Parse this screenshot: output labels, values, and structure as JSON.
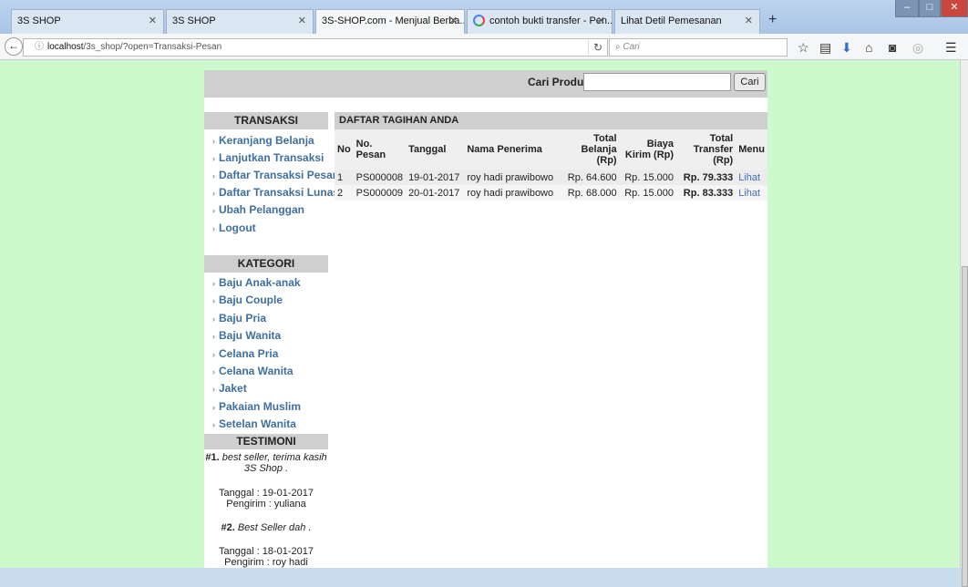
{
  "browser": {
    "tabs": [
      {
        "label": "3S SHOP"
      },
      {
        "label": "3S SHOP"
      },
      {
        "label": "3S-SHOP.com - Menjual Berba..."
      },
      {
        "label": "contoh bukti transfer - Pen..."
      },
      {
        "label": "Lihat Detil Pemesanan"
      }
    ],
    "url_host": "localhost",
    "url_path": "/3s_shop/?open=Transaksi-Pesan",
    "search_placeholder": "Cari"
  },
  "header": {
    "search_label": "Cari Produk",
    "search_value": "",
    "search_button": "Cari"
  },
  "sidebar": {
    "transaksi_title": "TRANSAKSI",
    "transaksi_items": [
      {
        "label": "Keranjang Belanja"
      },
      {
        "label": "Lanjutkan Transaksi"
      },
      {
        "label": "Daftar Transaksi Pesan"
      },
      {
        "label": "Daftar Transaksi Lunas"
      },
      {
        "label": "Ubah Pelanggan"
      },
      {
        "label": "Logout"
      }
    ],
    "kategori_title": "KATEGORI",
    "kategori_items": [
      {
        "label": "Baju Anak-anak"
      },
      {
        "label": "Baju Couple"
      },
      {
        "label": "Baju Pria"
      },
      {
        "label": "Baju Wanita"
      },
      {
        "label": "Celana Pria"
      },
      {
        "label": "Celana Wanita"
      },
      {
        "label": "Jaket"
      },
      {
        "label": "Pakaian Muslim"
      },
      {
        "label": "Setelan Wanita"
      }
    ],
    "testimoni_title": "TESTIMONI",
    "testimoni": [
      {
        "num": "#1.",
        "text": "best seller, terima kasih 3S Shop .",
        "date": "Tanggal : 19-01-2017",
        "sender": "Pengirim : yuliana"
      },
      {
        "num": "#2.",
        "text": "Best Seller dah .",
        "date": "Tanggal : 18-01-2017",
        "sender": "Pengirim : roy hadi"
      }
    ]
  },
  "main": {
    "title": "DAFTAR TAGIHAN ANDA",
    "columns": [
      "No",
      "No. Pesan",
      "Tanggal",
      "Nama Penerima",
      "Total Belanja (Rp)",
      "Biaya Kirim (Rp)",
      "Total Transfer (Rp)",
      "Menu"
    ],
    "rows": [
      {
        "no": "1",
        "no_pesan": "PS000008",
        "tanggal": "19-01-2017",
        "nama": "roy hadi prawibowo",
        "total_belanja": "Rp. 64.600",
        "biaya_kirim": "Rp. 15.000",
        "total_transfer": "Rp. 79.333",
        "menu": "Lihat"
      },
      {
        "no": "2",
        "no_pesan": "PS000009",
        "tanggal": "20-01-2017",
        "nama": "roy hadi prawibowo",
        "total_belanja": "Rp. 68.000",
        "biaya_kirim": "Rp. 15.000",
        "total_transfer": "Rp. 83.333",
        "menu": "Lihat"
      }
    ]
  },
  "colors": {
    "page_background": "#ccfacc",
    "panel_header": "#cfcfcf",
    "link": "#3f6f9f"
  }
}
